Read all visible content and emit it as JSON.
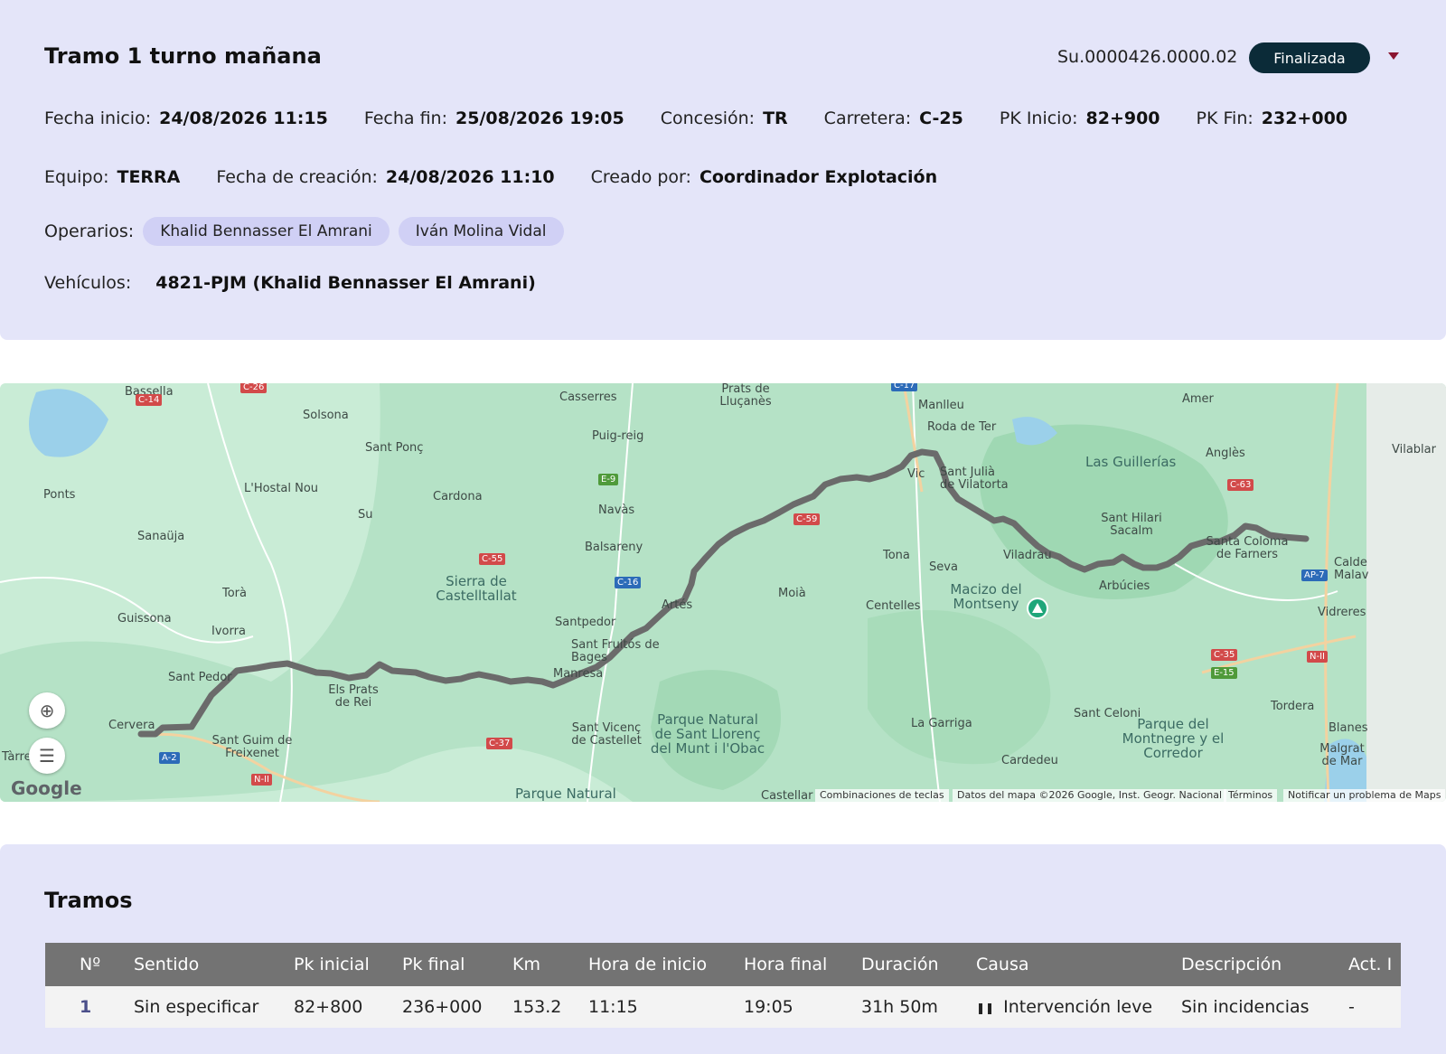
{
  "header": {
    "title": "Tramo 1 turno mañana",
    "code": "Su.0000426.0000.02",
    "status": "Finalizada",
    "fields_row1": [
      {
        "label": "Fecha inicio:",
        "value": "24/08/2026 11:15"
      },
      {
        "label": "Fecha fin:",
        "value": "25/08/2026 19:05"
      },
      {
        "label": "Concesión:",
        "value": "TR"
      },
      {
        "label": "Carretera:",
        "value": "C-25"
      },
      {
        "label": "PK Inicio:",
        "value": "82+900"
      },
      {
        "label": "PK Fin:",
        "value": "232+000"
      }
    ],
    "fields_row2": [
      {
        "label": "Equipo:",
        "value": "TERRA"
      },
      {
        "label": "Fecha de creación:",
        "value": "24/08/2026 11:10"
      },
      {
        "label": "Creado por:",
        "value": "Coordinador Explotación"
      }
    ],
    "operarios_label": "Operarios:",
    "operarios": [
      "Khalid Bennasser El Amrani",
      "Iván Molina Vidal"
    ],
    "vehiculos_label": "Vehículos:",
    "vehiculos": "4821-PJM (Khalid Bennasser El Amrani)"
  },
  "map": {
    "places": [
      "Bassella",
      "Solsona",
      "Casserres",
      "Prats de Lluçanès",
      "Manlleu",
      "Roda de Ter",
      "Amer",
      "Sant Ponç",
      "Puig-reig",
      "Las Guillerías",
      "Anglès",
      "Vilablar",
      "Ponts",
      "L'Hostal Nou",
      "Cardona",
      "Vic",
      "Sant Julià de Vilatorta",
      "Navàs",
      "Sanaüja",
      "Su",
      "Balsareny",
      "Sant Hilari Sacalm",
      "Santa Coloma de Farners",
      "Viladrau",
      "Tona",
      "Seva",
      "Sierra de Castelltallat",
      "Torà",
      "Artés",
      "Moià",
      "Macizo del Montseny",
      "Arbúcies",
      "Guissona",
      "Santpedor",
      "Centelles",
      "Ivorra",
      "Sant Fruitós de Bages",
      "Vidreres",
      "Sant Pedor",
      "Els Prats de Rei",
      "Manresa",
      "Sant Celoni",
      "Tordera",
      "Cervera",
      "Sant Guim de Freixenet",
      "Sant Vicenç de Castellet",
      "Parque Natural de Sant Llorenç del Munt i l'Obac",
      "La Garriga",
      "Parque del Montnegre y el Corredor",
      "Blanes",
      "Cardedeu",
      "Malgrat de Mar",
      "Parque Natural",
      "Castellar",
      "Tàrrega",
      "Calde Malav"
    ],
    "roads": [
      "C-14",
      "C-26",
      "E-9",
      "C-17",
      "C-59",
      "C-63",
      "C-55",
      "C-16",
      "AP-7",
      "C-35",
      "N-II",
      "E-15",
      "C-37",
      "A-2",
      "N-II"
    ],
    "google": "Google",
    "attribution": [
      "Combinaciones de teclas",
      "Datos del mapa ©2026 Google, Inst. Geogr. Nacional",
      "Términos",
      "Notificar un problema de Maps"
    ]
  },
  "tramos": {
    "title": "Tramos",
    "columns": [
      "Nº",
      "Sentido",
      "Pk inicial",
      "Pk final",
      "Km",
      "Hora de inicio",
      "Hora final",
      "Duración",
      "Causa",
      "Descripción",
      "Act. I"
    ],
    "rows": [
      {
        "n": "1",
        "sentido": "Sin especificar",
        "pk_inicial": "82+800",
        "pk_final": "236+000",
        "km": "153.2",
        "hora_inicio": "11:15",
        "hora_final": "19:05",
        "duracion": "31h 50m",
        "causa": "Intervención leve",
        "descripcion": "Sin incidencias",
        "act": "-"
      }
    ]
  }
}
